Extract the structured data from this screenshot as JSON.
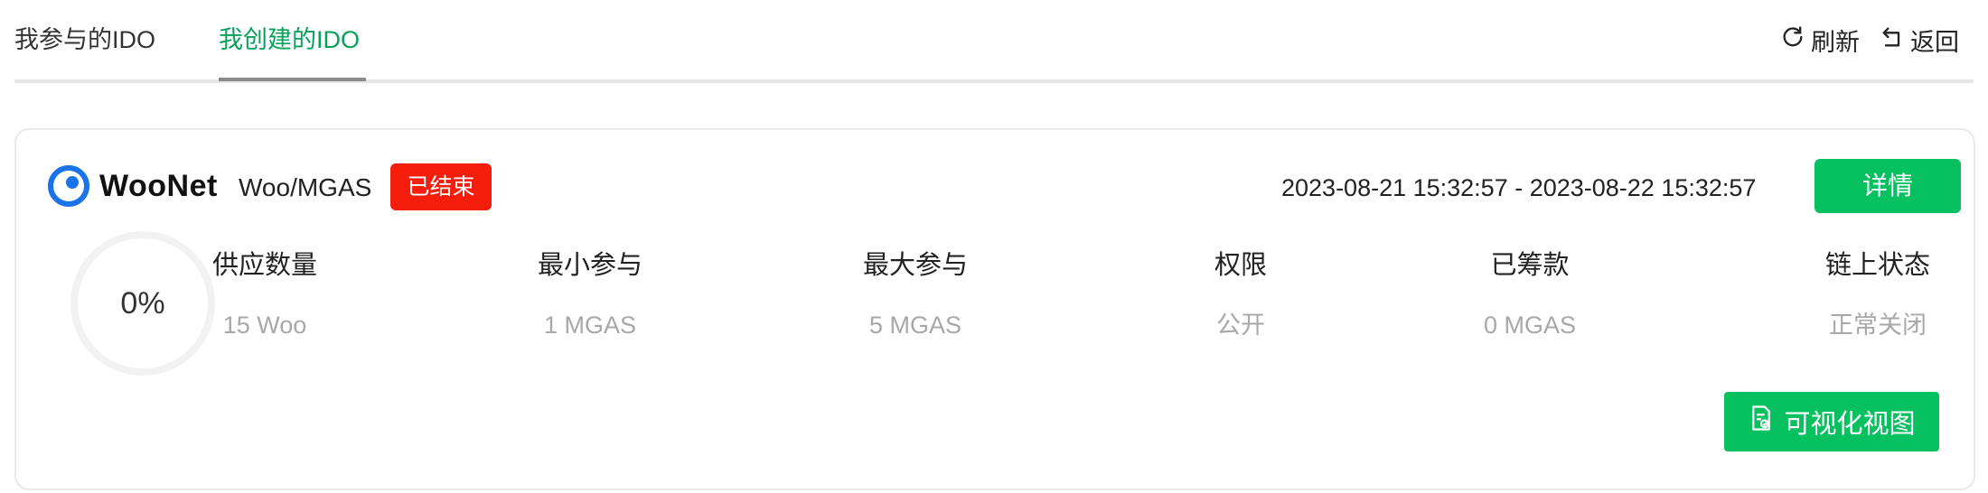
{
  "tabs": [
    {
      "label": "我参与的IDO",
      "active": false
    },
    {
      "label": "我创建的IDO",
      "active": true
    }
  ],
  "actions": {
    "refresh_label": "刷新",
    "back_label": "返回"
  },
  "card": {
    "logo_text": "WooNet",
    "pair": "Woo/MGAS",
    "status": "已结束",
    "time_range": "2023-08-21 15:32:57 - 2023-08-22 15:32:57",
    "details_label": "详情",
    "progress_text": "0%",
    "progress_value": 0,
    "stats": [
      {
        "label": "供应数量",
        "value": "15 Woo"
      },
      {
        "label": "最小参与",
        "value": "1 MGAS"
      },
      {
        "label": "最大参与",
        "value": "5 MGAS"
      },
      {
        "label": "权限",
        "value": "公开"
      },
      {
        "label": "已筹款",
        "value": "0 MGAS"
      },
      {
        "label": "链上状态",
        "value": "正常关闭"
      }
    ],
    "visualize_label": "可视化视图"
  },
  "colors": {
    "accent_green": "#07c160",
    "active_tab": "#07a15a",
    "status_red": "#f51d0c",
    "brand_blue": "#1a73e8"
  }
}
